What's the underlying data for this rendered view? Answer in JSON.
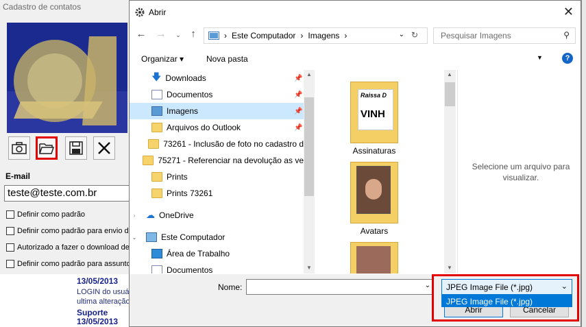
{
  "bg_app": {
    "title": "Cadastro de contatos",
    "email_label": "E-mail",
    "email_value": "teste@teste.com.br",
    "checkboxes": [
      "Definir como padrão",
      "Definir como padrão para envio de",
      "Autorizado a fazer o download de",
      "Definir como padrão para assunto"
    ],
    "lower": {
      "date1": "13/05/2013",
      "login_text": "LOGIN do usuá",
      "last_change": "ultima alteração",
      "support": "Suporte",
      "date2": "13/05/2013"
    }
  },
  "dialog": {
    "title": "Abrir",
    "address": [
      "Este Computador",
      "Imagens"
    ],
    "search_placeholder": "Pesquisar Imagens",
    "toolbar": {
      "organize": "Organizar ▾",
      "new_folder": "Nova pasta"
    },
    "nav_items": [
      {
        "label": "Downloads",
        "icon": "download-icon",
        "pinned": true
      },
      {
        "label": "Documentos",
        "icon": "document-icon",
        "pinned": true
      },
      {
        "label": "Imagens",
        "icon": "pictures-icon",
        "pinned": true,
        "selected": true
      },
      {
        "label": "Arquivos do Outlook",
        "icon": "folder-icon",
        "pinned": true
      },
      {
        "label": "73261 - Inclusão de foto no cadastro d",
        "icon": "folder-icon"
      },
      {
        "label": "75271 - Referenciar na devolução as ve",
        "icon": "folder-icon"
      },
      {
        "label": "Prints",
        "icon": "folder-icon"
      },
      {
        "label": "Prints 73261",
        "icon": "folder-icon"
      },
      {
        "label": "OneDrive",
        "icon": "cloud-icon"
      },
      {
        "label": "Este Computador",
        "icon": "computer-icon"
      },
      {
        "label": "Área de Trabalho",
        "icon": "desktop-icon"
      },
      {
        "label": "Documentos",
        "icon": "document-icon"
      }
    ],
    "files": [
      {
        "label": "Assinaturas"
      },
      {
        "label": "Avatars"
      },
      {
        "label": ""
      }
    ],
    "preview_text": "Selecione um arquivo para visualizar.",
    "name_label": "Nome:",
    "file_type": "JPEG Image File (*.jpg)",
    "file_type_option": "JPEG Image File (*.jpg)",
    "open_button": "Abrir",
    "cancel_button": "Cancelar"
  }
}
